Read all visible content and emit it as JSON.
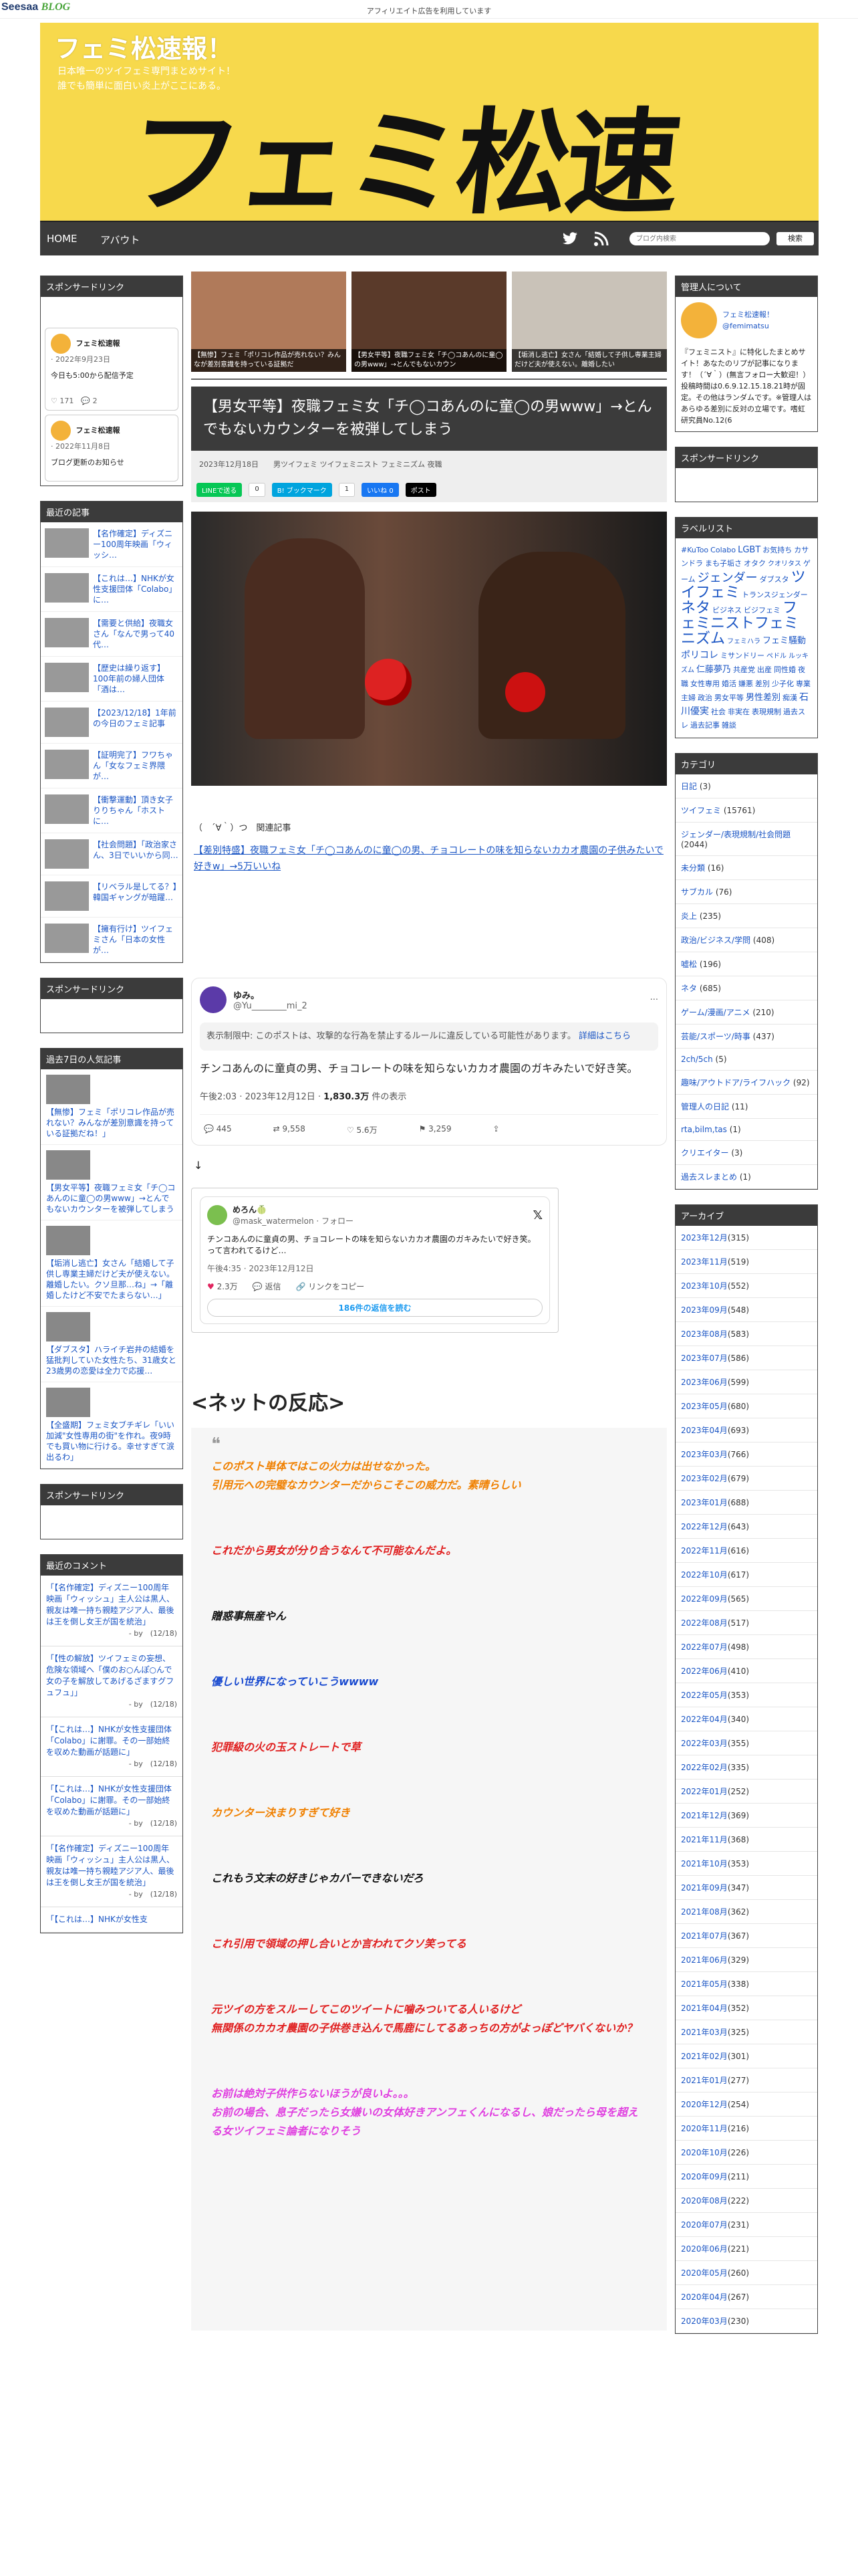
{
  "topbar": {
    "logo_a": "Seesaa",
    "logo_b": "BLOG",
    "affiliate": "アフィリエイト広告を利用しています"
  },
  "banner": {
    "title": "フェミ松速報！",
    "sub1": "日本唯一のツイフェミ専門まとめサイト！",
    "sub2": "誰でも簡単に面白い炎上がここにある。",
    "logo_text": "フェミ松速報!"
  },
  "nav": {
    "home": "HOME",
    "about": "アバウト",
    "search_placeholder": "ブログ内検索",
    "search_btn": "検索"
  },
  "left": {
    "sponsor": "スポンサードリンク",
    "tweet1": {
      "name": "フェミ松速報",
      "date": "· 2022年9月23日",
      "text": "今日も5:00から配信予定"
    },
    "tweet1_stats": {
      "likes": "171",
      "replies": "2"
    },
    "tweet2": {
      "name": "フェミ松速報",
      "date": "· 2022年11月8日",
      "text": "ブログ更新のお知らせ"
    },
    "recent_title": "最近の記事",
    "recent": [
      "【名作確定】ディズニー100周年映画「ウィッシ…",
      "【これは…】NHKが女性支援団体「Colabo」に…",
      "【需要と供給】夜職女さん「なんで男って40代…",
      "【歴史は繰り返す】100年前の婦人団体「酒は…",
      "【2023/12/18】1年前の今日のフェミ記事",
      "【証明完了】フワちゃん「女なフェミ界隈が…",
      "【衝撃運動】頂き女子りりちゃん「ホストに…",
      "【社会問題】「政治家さん、3日でいいから同…",
      "【リベラル是してる？】韓国ギャングが暗躍…",
      "【擁有行け】ツイフェミさん「日本の女性が…"
    ],
    "sponsor2": "スポンサードリンク",
    "popular_title": "過去7日の人気記事",
    "popular": [
      "【無惨】フェミ「ポリコレ作品が売れない？みんなが差別意識を持っている証拠だね！」",
      "【男女平等】夜職フェミ女「チ◯コあんのに童◯の男www」→とんでもないカウンターを被弾してしまう",
      "【垢消し逃亡】女さん「結婚して子供し専業主婦だけど夫が使えない。離婚したい。クソ旦那…ね」→「離婚したけど不安でたまらない…」",
      "【ダブスタ】ハライチ岩井の結婚を猛批判していた女性たち、31歳女と23歳男の恋愛は全力で応援…",
      "【全盛期】フェミ女ブチギレ「いい加減\"女性専用の街\"を作れ。夜9時でも買い物に行ける。幸せすぎて涙出るわ」"
    ],
    "sponsor3": "スポンサードリンク",
    "comments_title": "最近のコメント",
    "comments": [
      {
        "text": "「【名作確定】ディズニー100周年映画「ウィッシュ」主人公は黒人、親友は唯一持ち親睦アジア人、最後は王を倒し女王が国を統治」",
        "by": "- by　(12/18)"
      },
      {
        "text": "「【性の解放】ツイフェミの妄想、危険な領域へ「僕のお○んぽ○んで女の子を解放してあげるざますグフュフュ」」",
        "by": "- by　(12/18)"
      },
      {
        "text": "「【これは…】NHKが女性支援団体「Colabo」に謝罪。その一部始終を収めた動画が話題に」",
        "by": "- by　(12/18)"
      },
      {
        "text": "「【これは…】NHKが女性支援団体「Colabo」に謝罪。その一部始終を収めた動画が話題に」",
        "by": "- by　(12/18)"
      },
      {
        "text": "「【名作確定】ディズニー100周年映画「ウィッシュ」主人公は黒人、親友は唯一持ち親睦アジア人、最後は王を倒し女王が国を統治」",
        "by": "- by　(12/18)"
      },
      {
        "text": "「【これは…】NHKが女性支"
      }
    ]
  },
  "center": {
    "thumbs": [
      "【無惨】フェミ「ポリコレ作品が売れない？みんなが差別意識を持っている証拠だ",
      "【男女平等】夜職フェミ女「チ◯コあんのに童◯の男www」→とんでもないカウン",
      "【垢消し逃亡】女さん「結婚して子供し専業主婦だけど夫が使えない。離婚したい"
    ],
    "title": "【男女平等】夜職フェミ女「チ◯コあんのに童◯の男www」→とんでもないカウンターを被弾してしまう",
    "meta": "2023年12月18日　　男ツイフェミ ツイフェミニスト フェミニズム 夜職",
    "share": {
      "line": "LINEで送る",
      "count0": "0",
      "hatena": "B! ブックマーク",
      "hatena_count": "1",
      "like": "いいね 0",
      "x": "ポスト"
    },
    "face": "（　´∀｀）つ　関連記事",
    "related": "【差別特盛】夜職フェミ女「チ◯コあんのに童◯の男、チョコレートの味を知らないカカオ農園の子供みたいで好きw」→5万いいね",
    "xpost": {
      "name": "ゆみ。",
      "handle": "@Yu________mi_2",
      "notice1": "表示制限中: このポストは、攻撃的な行為を禁止するルールに違反している可能性があります。",
      "notice_link": "詳細はこちら",
      "text": "チンコあんのに童貞の男、チョコレートの味を知らないカカオ農園のガキみたいで好き笑。",
      "time": "午後2:03 · 2023年12月12日 · ",
      "views": "1,830.3万",
      "views_suffix": " 件の表示",
      "replies": "445",
      "reposts": "9,558",
      "likes": "5.6万",
      "bookmarks": "3,259"
    },
    "arrow": "↓",
    "quote_tweet": {
      "name": "めろん🍈",
      "handle": "@mask_watermelon · フォロー",
      "text": "チンコあんのに童貞の男、チョコレートの味を知らないカカオ農園のガキみたいで好き笑。って言われてるけど…",
      "time": "午後4:35 · 2023年12月12日",
      "likes": "2.3万",
      "reply": "返信",
      "copy": "リンクをコピー",
      "more": "186件の返信を読む"
    },
    "net_title": "<ネットの反応>",
    "quotes": [
      {
        "c": "o",
        "lines": [
          "このポスト単体ではこの火力は出せなかった。",
          "引用元への完璧なカウンターだからこそこの威力だ。素晴らしい"
        ]
      },
      {
        "c": "r",
        "lines": [
          "これだから男女が分り合うなんて不可能なんだよ。"
        ]
      },
      {
        "c": "k",
        "lines": [
          "贈惑事無産やん"
        ]
      },
      {
        "c": "b",
        "lines": [
          "優しい世界になっていこうwwww"
        ]
      },
      {
        "c": "r",
        "lines": [
          "犯罪級の火の玉ストレートで草"
        ]
      },
      {
        "c": "o",
        "lines": [
          "カウンター決まりすぎて好き"
        ]
      },
      {
        "c": "k",
        "lines": [
          "これもう文末の好きじゃカバーできないだろ"
        ]
      },
      {
        "c": "r",
        "lines": [
          "これ引用で領域の押し合いとか言われてクソ笑ってる"
        ]
      },
      {
        "c": "r",
        "lines": [
          "元ツイの方をスルーしてこのツイートに噛みついてる人いるけど",
          "無関係のカカオ農園の子供巻き込んで馬鹿にしてるあっちの方がよっぽどヤバくないか？"
        ]
      },
      {
        "c": "p",
        "lines": [
          "お前は絶対子供作らないほうが良いよ。。。",
          "お前の場合、息子だったら女嫌いの女体好きアンフェくんになるし、娘だったら母を超える女ツイフェミ論者になりそう"
        ]
      }
    ]
  },
  "right": {
    "about_title": "管理人について",
    "about_name": "フェミ松速報！",
    "about_handle": "@femimatsu",
    "about_text": "『フェミニスト』に特化したまとめサイト！あなたのリプが記事になります！（´∀｀）(無言フォロー大歓迎！）投稿時間は0.6.9.12.15.18.21時が固定。その他はランダムです。※管理人はあらゆる差別に反対の立場です。嗜虹研究員No.12(6",
    "sponsor": "スポンサードリンク",
    "tags_title": "ラベルリスト",
    "tags": [
      "#KuToo",
      "Colabo",
      "LGBT",
      "お気持ち",
      "カサンドラ",
      "まも子垢さ",
      "オタク",
      "クオリタス",
      "ゲーム",
      "ジェンダー",
      "ダブスタ",
      "ツイフェミ",
      "トランスジェンダー",
      "ネタ",
      "ビジネス",
      "ビジフェミ",
      "フェミニストフェミニズム",
      "フェミハラ",
      "フェミ騒動",
      "ポリコレ",
      "ミサンドリー",
      "ペドル",
      "ルッキズム",
      "仁藤夢乃",
      "共産党",
      "出産",
      "同性婚",
      "夜職",
      "女性専用",
      "婚活",
      "嫌悪",
      "差別",
      "少子化",
      "専業主婦",
      "政治",
      "男女平等",
      "男性差別",
      "痴漢",
      "石川優実",
      "社会",
      "非実在",
      "表現規制",
      "過去スレ",
      "過去記事",
      "雑談"
    ],
    "cat_title": "カテゴリ",
    "categories": [
      {
        "name": "日記",
        "n": "(3)"
      },
      {
        "name": "ツイフェミ",
        "n": "(15761)"
      },
      {
        "name": "ジェンダー/表現規制/社会問題",
        "n": "(2044)"
      },
      {
        "name": "未分類",
        "n": "(16)"
      },
      {
        "name": "サブカル",
        "n": "(76)"
      },
      {
        "name": "炎上",
        "n": "(235)"
      },
      {
        "name": "政治/ビジネス/学問",
        "n": "(408)"
      },
      {
        "name": "嘘松",
        "n": "(196)"
      },
      {
        "name": "ネタ",
        "n": "(685)"
      },
      {
        "name": "ゲーム/漫画/アニメ",
        "n": "(210)"
      },
      {
        "name": "芸能/スポーツ/時事",
        "n": "(437)"
      },
      {
        "name": "2ch/5ch",
        "n": "(5)"
      },
      {
        "name": "趣味/アウトドア/ライフハック",
        "n": "(92)"
      },
      {
        "name": "管理人の日記",
        "n": "(11)"
      },
      {
        "name": "rta,bilm,tas",
        "n": "(1)"
      },
      {
        "name": "クリエイター",
        "n": "(3)"
      },
      {
        "name": "過去スレまとめ",
        "n": "(1)"
      }
    ],
    "arc_title": "アーカイブ",
    "archives": [
      {
        "m": "2023年12月",
        "n": "(315)"
      },
      {
        "m": "2023年11月",
        "n": "(519)"
      },
      {
        "m": "2023年10月",
        "n": "(552)"
      },
      {
        "m": "2023年09月",
        "n": "(548)"
      },
      {
        "m": "2023年08月",
        "n": "(583)"
      },
      {
        "m": "2023年07月",
        "n": "(586)"
      },
      {
        "m": "2023年06月",
        "n": "(599)"
      },
      {
        "m": "2023年05月",
        "n": "(680)"
      },
      {
        "m": "2023年04月",
        "n": "(693)"
      },
      {
        "m": "2023年03月",
        "n": "(766)"
      },
      {
        "m": "2023年02月",
        "n": "(679)"
      },
      {
        "m": "2023年01月",
        "n": "(688)"
      },
      {
        "m": "2022年12月",
        "n": "(643)"
      },
      {
        "m": "2022年11月",
        "n": "(616)"
      },
      {
        "m": "2022年10月",
        "n": "(617)"
      },
      {
        "m": "2022年09月",
        "n": "(565)"
      },
      {
        "m": "2022年08月",
        "n": "(517)"
      },
      {
        "m": "2022年07月",
        "n": "(498)"
      },
      {
        "m": "2022年06月",
        "n": "(410)"
      },
      {
        "m": "2022年05月",
        "n": "(353)"
      },
      {
        "m": "2022年04月",
        "n": "(340)"
      },
      {
        "m": "2022年03月",
        "n": "(355)"
      },
      {
        "m": "2022年02月",
        "n": "(335)"
      },
      {
        "m": "2022年01月",
        "n": "(252)"
      },
      {
        "m": "2021年12月",
        "n": "(369)"
      },
      {
        "m": "2021年11月",
        "n": "(368)"
      },
      {
        "m": "2021年10月",
        "n": "(353)"
      },
      {
        "m": "2021年09月",
        "n": "(347)"
      },
      {
        "m": "2021年08月",
        "n": "(362)"
      },
      {
        "m": "2021年07月",
        "n": "(367)"
      },
      {
        "m": "2021年06月",
        "n": "(329)"
      },
      {
        "m": "2021年05月",
        "n": "(338)"
      },
      {
        "m": "2021年04月",
        "n": "(352)"
      },
      {
        "m": "2021年03月",
        "n": "(325)"
      },
      {
        "m": "2021年02月",
        "n": "(301)"
      },
      {
        "m": "2021年01月",
        "n": "(277)"
      },
      {
        "m": "2020年12月",
        "n": "(254)"
      },
      {
        "m": "2020年11月",
        "n": "(216)"
      },
      {
        "m": "2020年10月",
        "n": "(226)"
      },
      {
        "m": "2020年09月",
        "n": "(211)"
      },
      {
        "m": "2020年08月",
        "n": "(222)"
      },
      {
        "m": "2020年07月",
        "n": "(231)"
      },
      {
        "m": "2020年06月",
        "n": "(221)"
      },
      {
        "m": "2020年05月",
        "n": "(260)"
      },
      {
        "m": "2020年04月",
        "n": "(267)"
      },
      {
        "m": "2020年03月",
        "n": "(230)"
      }
    ]
  },
  "colors": {
    "accent": "#3b3b3b",
    "banner": "#f7d94c",
    "link": "#1a55c4"
  }
}
